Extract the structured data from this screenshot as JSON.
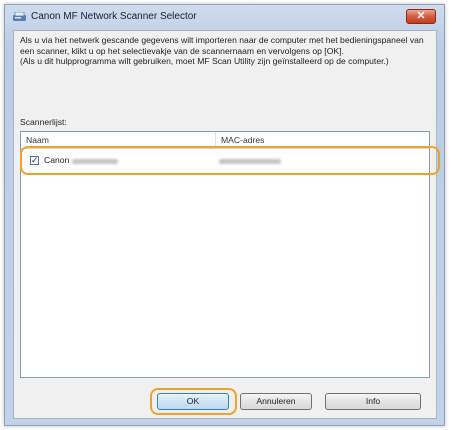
{
  "window": {
    "title": "Canon MF Network Scanner Selector",
    "close_label": "✕"
  },
  "description": {
    "line1": "Als u via het netwerk gescande gegevens wilt importeren naar de computer met het bedieningspaneel van een scanner, klikt u op het selectievakje van de scannernaam en vervolgens op [OK].",
    "line2": "(Als u dit hulpprogramma wilt gebruiken, moet MF Scan Utility zijn geïnstalleerd op de computer.)"
  },
  "scanner_list": {
    "label": "Scannerlijst:",
    "columns": {
      "name": "Naam",
      "mac": "MAC-adres"
    },
    "rows": [
      {
        "checked": true,
        "name": "Canon",
        "model_redacted": true,
        "mac_redacted": true
      }
    ]
  },
  "buttons": {
    "ok": "OK",
    "cancel": "Annuleren",
    "info": "Info"
  },
  "colors": {
    "highlight": "#f0a22c",
    "title_bar": "#c3d2e6",
    "close_button": "#d45c3f"
  }
}
